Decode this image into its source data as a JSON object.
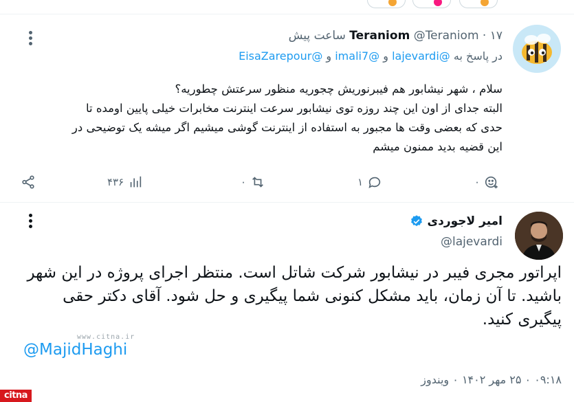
{
  "reply_tweet": {
    "display_name": "Teraniom",
    "handle": "@Teraniom",
    "time": "۱۷ ساعت پیش",
    "replying_to_prefix": "در پاسخ به",
    "mention_1": "@lajevardi",
    "and_1": "و",
    "mention_2": "@imali7",
    "and_2": "و",
    "mention_3": "@EisaZarepour",
    "body_lines": [
      "سلام ، شهر نیشابور هم فیبرنوریش چجوریه منظور سرعتش چطوریه؟",
      "البته جدای از اون این چند روزه توی نیشابور سرعت اینترنت مخابرات خیلی پایین اومده تا",
      "حدی که بعضی وقت ها مجبور به استفاده از اینترنت گوشی میشیم اگر میشه یک توضیحی در",
      "این قضیه بدید ممنون میشم"
    ],
    "views_count": "۴۳۶",
    "retweet_count": "۰",
    "reply_count": "۱",
    "like_count": "۰"
  },
  "main_tweet": {
    "display_name": "امیر لاجوردی",
    "handle": "@lajevardi",
    "body_lines": [
      "اپراتور مجری فیبر در نیشابور شرکت شاتل است. منتظر اجرای پروژه  در این شهر",
      "باشید. تا آن زمان، باید  مشکل کنونی شما پیگیری و حل شود. آقای دکتر حقی",
      "پیگیری کنید."
    ],
    "mention": "@MajidHaghi",
    "datetime": "۰۹:۱۸ ۰ ۲۵ مهر ۱۴۰۲ ۰ ویندوز"
  },
  "watermark": "www.citna.ir",
  "logo_text": "citna",
  "colors": {
    "accent": "#1d9bf0",
    "text": "#0f1419",
    "muted": "#536471",
    "divider": "#eff3f4",
    "logo_red": "#d7191e"
  },
  "icons": [
    "more-icon",
    "share-icon",
    "views-icon",
    "retweet-icon",
    "reply-icon",
    "like-icon",
    "verified-icon"
  ]
}
